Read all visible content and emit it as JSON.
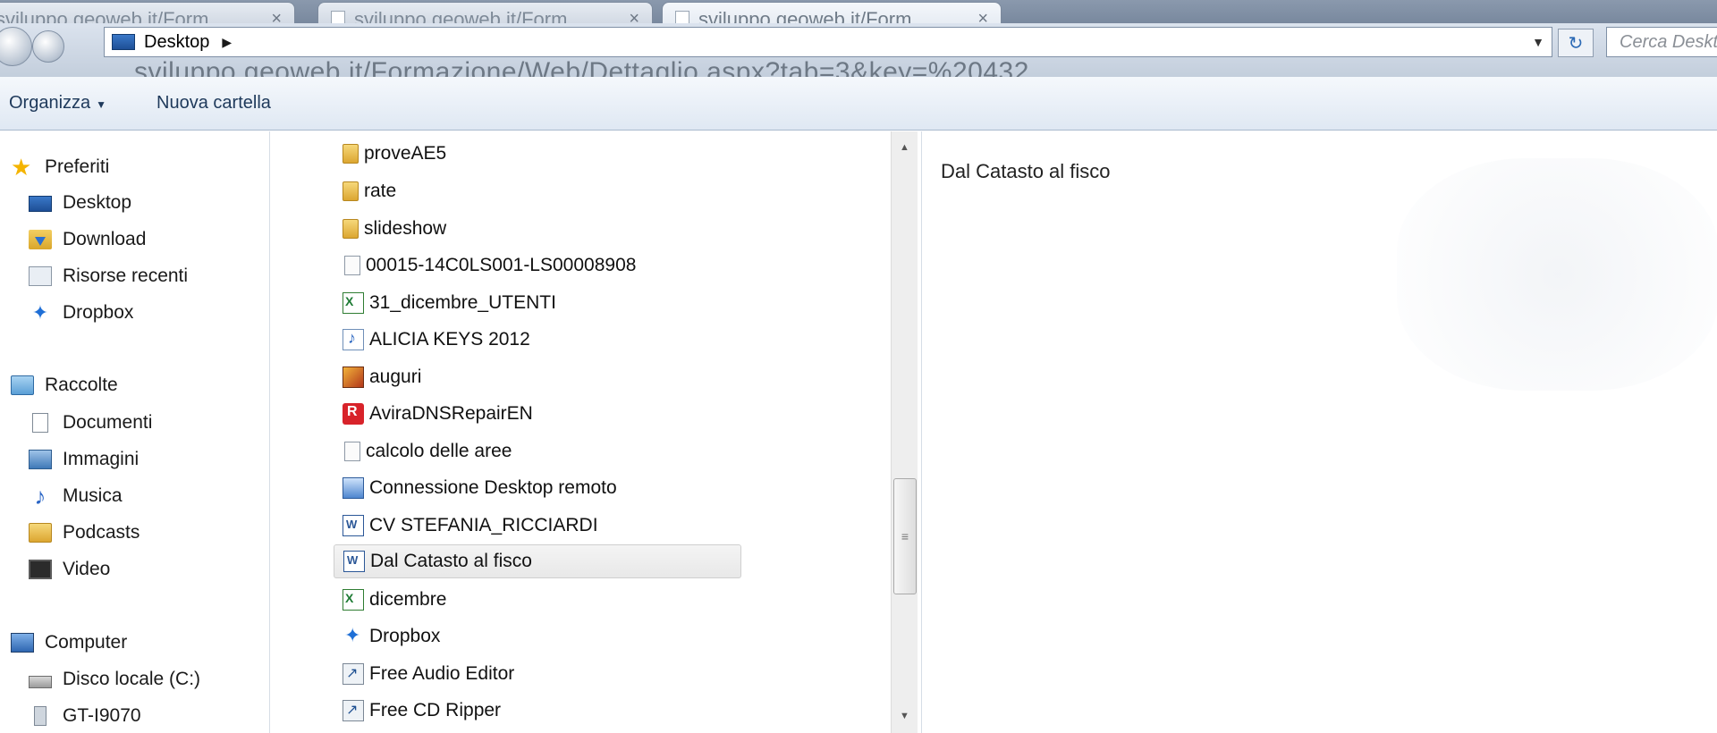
{
  "browser": {
    "tabs": [
      {
        "label": "sviluppo.geoweb.it/Form"
      },
      {
        "label": "sviluppo.geoweb.it/Form"
      },
      {
        "label": "sviluppo.geoweb.it/Form"
      }
    ],
    "tab_close": "×",
    "ghost_url": "sviluppo.geoweb.it/Formazione/Web/Dettaglio.aspx?tab=3&key=%20432"
  },
  "address_bar": {
    "location": "Desktop",
    "separator": "▶",
    "dropdown": "▼",
    "refresh": "↻",
    "search_placeholder": "Cerca Desktop"
  },
  "toolbar": {
    "organize": "Organizza",
    "organize_caret": "▼",
    "new_folder": "Nuova cartella"
  },
  "nav": {
    "favorites_label": "Preferiti",
    "favorites": [
      {
        "label": "Desktop",
        "icon": "desktop-icon"
      },
      {
        "label": "Download",
        "icon": "download-icon"
      },
      {
        "label": "Risorse recenti",
        "icon": "recent-places-icon"
      },
      {
        "label": "Dropbox",
        "icon": "dropbox-icon"
      }
    ],
    "libraries_label": "Raccolte",
    "libraries": [
      {
        "label": "Documenti",
        "icon": "documents-icon"
      },
      {
        "label": "Immagini",
        "icon": "pictures-icon"
      },
      {
        "label": "Musica",
        "icon": "music-icon"
      },
      {
        "label": "Podcasts",
        "icon": "folder-icon"
      },
      {
        "label": "Video",
        "icon": "video-icon"
      }
    ],
    "computer_label": "Computer",
    "computer": [
      {
        "label": "Disco locale (C:)",
        "icon": "drive-icon"
      },
      {
        "label": "GT-I9070",
        "icon": "phone-icon"
      }
    ]
  },
  "files": [
    {
      "name": "proveAE5",
      "type": "folder"
    },
    {
      "name": "rate",
      "type": "folder"
    },
    {
      "name": "slideshow",
      "type": "folder"
    },
    {
      "name": "00015-14C0LS001-LS00008908",
      "type": "generic"
    },
    {
      "name": "31_dicembre_UTENTI",
      "type": "excel"
    },
    {
      "name": "ALICIA KEYS 2012",
      "type": "audio"
    },
    {
      "name": "auguri",
      "type": "image"
    },
    {
      "name": "AviraDNSRepairEN",
      "type": "avira"
    },
    {
      "name": "calcolo delle aree",
      "type": "generic"
    },
    {
      "name": "Connessione Desktop remoto",
      "type": "rdp"
    },
    {
      "name": "CV STEFANIA_RICCIARDI",
      "type": "word"
    },
    {
      "name": "Dal Catasto al fisco",
      "type": "word",
      "selected": true
    },
    {
      "name": "dicembre",
      "type": "excel"
    },
    {
      "name": "Dropbox",
      "type": "dropbox"
    },
    {
      "name": "Free Audio Editor",
      "type": "shortcut"
    },
    {
      "name": "Free CD Ripper",
      "type": "shortcut"
    }
  ],
  "preview": {
    "title": "Dal Catasto al fisco"
  },
  "scroll": {
    "up": "▲",
    "down": "▼",
    "grip": "≡"
  }
}
